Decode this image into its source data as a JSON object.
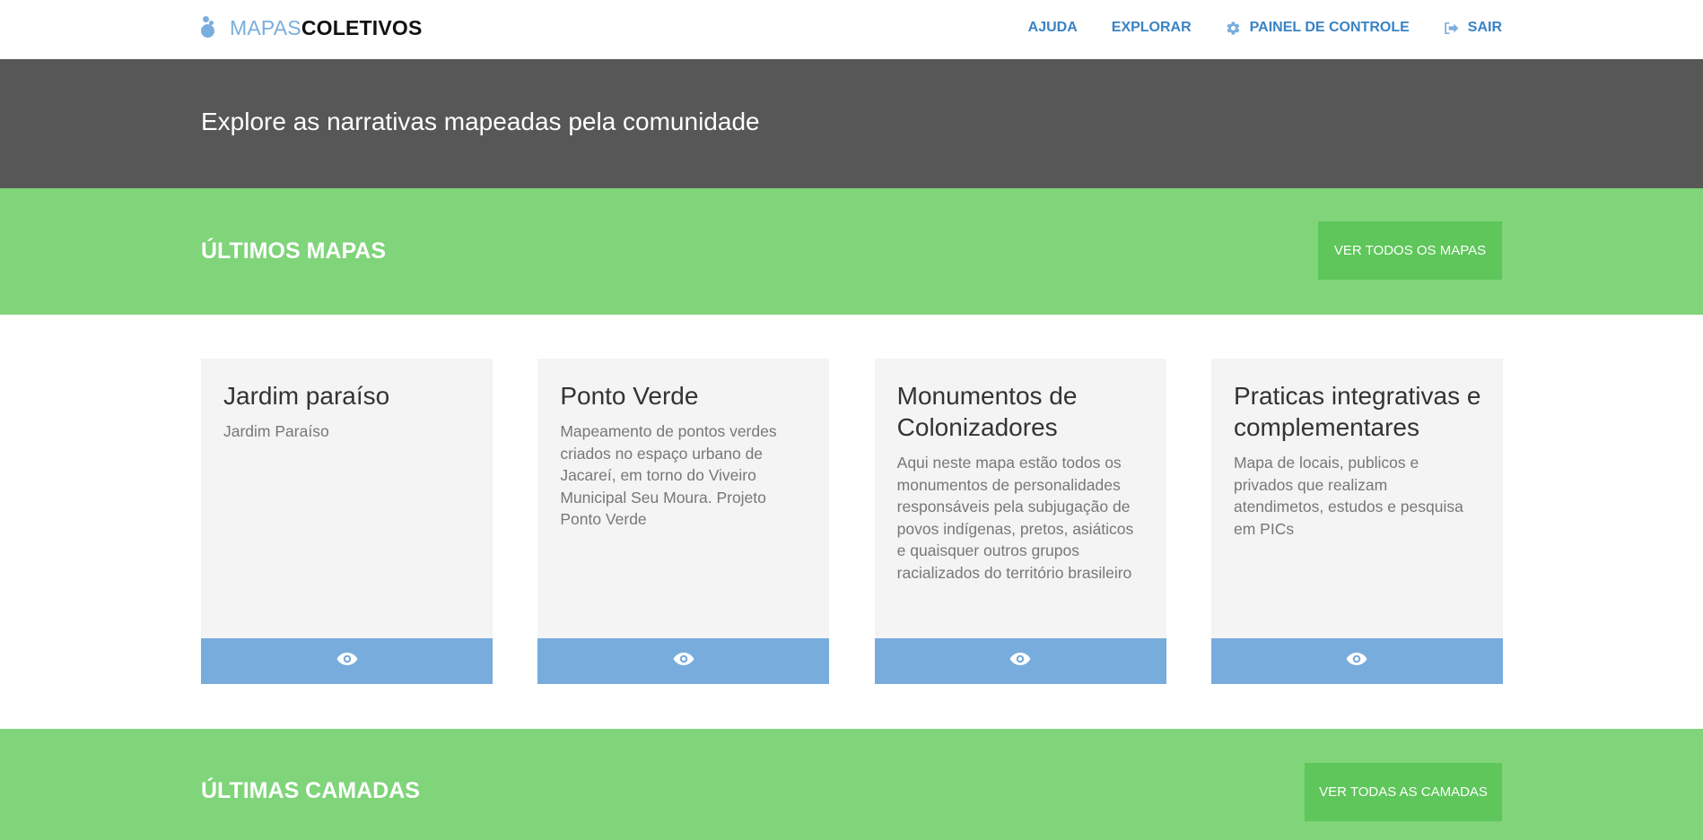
{
  "header": {
    "logo_light": "MAPAS",
    "logo_bold": "COLETIVOS",
    "nav": [
      {
        "label": "AJUDA",
        "icon": ""
      },
      {
        "label": "EXPLORAR",
        "icon": ""
      },
      {
        "label": "PAINEL DE CONTROLE",
        "icon": "gear-icon"
      },
      {
        "label": "SAIR",
        "icon": "sign-out-icon"
      }
    ]
  },
  "banner": {
    "text": "Explore as narrativas mapeadas pela comunidade"
  },
  "maps_section": {
    "title": "ÚLTIMOS MAPAS",
    "button": "VER TODOS OS MAPAS"
  },
  "cards": [
    {
      "title": "Jardim paraíso",
      "description": "Jardim Paraíso",
      "footer_icon": "eye-icon"
    },
    {
      "title": "Ponto Verde",
      "description": "Mapeamento de pontos verdes criados no espaço urbano de Jacareí, em torno do Viveiro Municipal Seu Moura. Projeto Ponto Verde",
      "footer_icon": "eye-icon"
    },
    {
      "title": "Monumentos de Colonizadores",
      "description": "Aqui neste mapa estão todos os monumentos de personalidades responsáveis pela subjugação de povos indígenas, pretos, asiáticos e quaisquer outros grupos racializados do território brasileiro",
      "footer_icon": "eye-icon"
    },
    {
      "title": "Praticas integrativas e complementares",
      "description": "Mapa de locais, publicos e privados que realizam atendimetos, estudos e pesquisa em PICs",
      "footer_icon": "eye-icon"
    }
  ],
  "layers_section": {
    "title": "ÚLTIMAS CAMADAS",
    "button": "VER TODAS AS CAMADAS"
  },
  "colors": {
    "accent_blue": "#3a82c4",
    "banner_gray": "#575757",
    "section_green": "#80d47a",
    "button_green": "#5ec65a",
    "card_footer_blue": "#77acdd"
  }
}
